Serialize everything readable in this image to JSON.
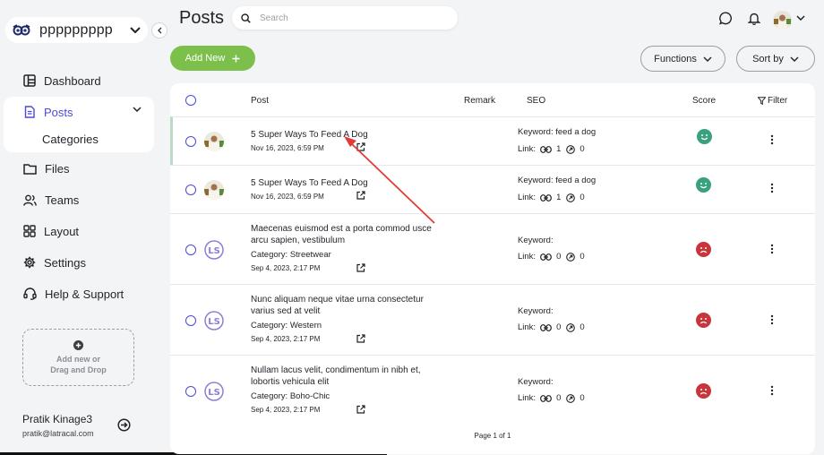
{
  "sidebar": {
    "workspace_name": "ppppppppp",
    "items": [
      {
        "label": "Dashboard",
        "icon": "dashboard-icon"
      },
      {
        "label": "Posts",
        "icon": "document-icon"
      },
      {
        "label": "Files",
        "icon": "folder-icon"
      },
      {
        "label": "Teams",
        "icon": "users-icon"
      },
      {
        "label": "Layout",
        "icon": "grid-icon"
      },
      {
        "label": "Settings",
        "icon": "gear-icon"
      },
      {
        "label": "Help & Support",
        "icon": "headset-icon"
      }
    ],
    "sub_items": [
      {
        "label": "Categories"
      }
    ],
    "dropzone_text": "Add new or Drag and Drop",
    "user": {
      "name": "Pratik Kinage3",
      "email": "pratik@latracal.com"
    }
  },
  "header": {
    "title": "Posts",
    "search_placeholder": "Search"
  },
  "toolbar": {
    "add_label": "Add New",
    "functions_label": "Functions",
    "sort_label": "Sort by"
  },
  "table": {
    "headers": {
      "post": "Post",
      "remark": "Remark",
      "seo": "SEO",
      "score": "Score",
      "filter": "Filter"
    },
    "rows": [
      {
        "title": "5 Super Ways To Feed A Dog",
        "category": "",
        "date": "Nov 16, 2023, 6:59 PM",
        "keyword": "Keyword: feed a dog",
        "link_label": "Link:",
        "internal_links": "1",
        "external_links": "0",
        "score": "good",
        "thumb": "photo"
      },
      {
        "title": "5 Super Ways To Feed A Dog",
        "category": "",
        "date": "Nov 16, 2023, 6:59 PM",
        "keyword": "Keyword: feed a dog",
        "link_label": "Link:",
        "internal_links": "1",
        "external_links": "0",
        "score": "good",
        "thumb": "photo"
      },
      {
        "title": "Maecenas euismod est a porta commod usce arcu sapien, vestibulum",
        "category": "Category: Streetwear",
        "date": "Sep 4, 2023, 2:17 PM",
        "keyword": "Keyword:",
        "link_label": "Link:",
        "internal_links": "0",
        "external_links": "0",
        "score": "bad",
        "thumb": "logo"
      },
      {
        "title": "Nunc aliquam neque vitae urna consectetur varius sed at velit",
        "category": "Category: Western",
        "date": "Sep 4, 2023, 2:17 PM",
        "keyword": "Keyword:",
        "link_label": "Link:",
        "internal_links": "0",
        "external_links": "0",
        "score": "bad",
        "thumb": "logo"
      },
      {
        "title": "Nullam lacus velit, condimentum in nibh et, lobortis vehicula elit",
        "category": "Category: Boho-Chic",
        "date": "Sep 4, 2023, 2:17 PM",
        "keyword": "Keyword:",
        "link_label": "Link:",
        "internal_links": "0",
        "external_links": "0",
        "score": "bad",
        "thumb": "logo"
      }
    ],
    "pagination": "Page 1 of 1"
  },
  "colors": {
    "accent": "#4a4ad6",
    "add_button": "#7cc04b",
    "score_good": "#3aa17e",
    "score_bad": "#c8353b",
    "annotation_arrow": "#e53935"
  }
}
